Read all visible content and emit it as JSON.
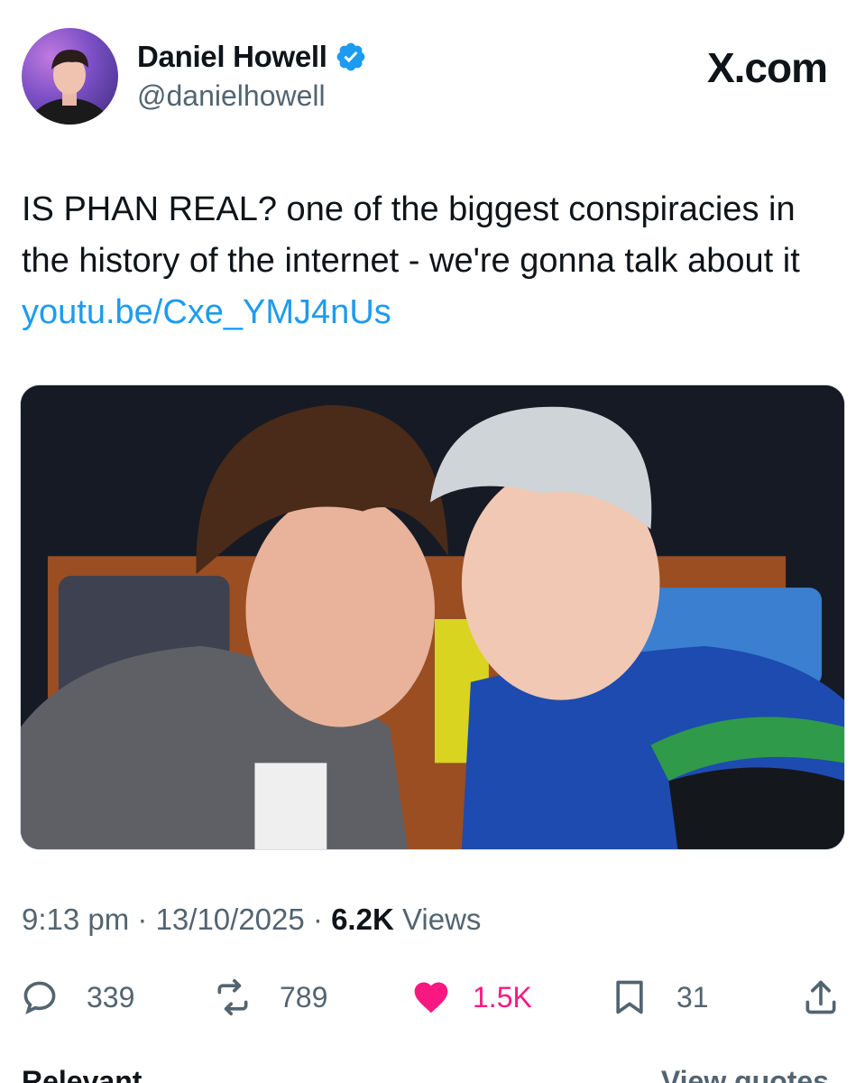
{
  "header": {
    "display_name": "Daniel Howell",
    "handle": "@danielhowell",
    "brand": "X.com",
    "verified_icon": "verified-badge-icon",
    "verified_color": "#1d9bf0"
  },
  "tweet": {
    "text": "IS PHAN REAL? one of the biggest conspiracies in the history of the internet - we're gonna talk about it ",
    "link": "youtu.be/Cxe_YMJ4nUs",
    "link_color": "#1d9bf0"
  },
  "meta": {
    "time": "9:13 pm",
    "separator1": " · ",
    "date": "13/10/2025",
    "separator2": " · ",
    "views_count": "6.2K",
    "views_label": " Views"
  },
  "actions": {
    "reply": {
      "icon": "reply-icon",
      "count": "339"
    },
    "repost": {
      "icon": "repost-icon",
      "count": "789"
    },
    "like": {
      "icon": "heart-icon",
      "count": "1.5K",
      "color": "#f91880"
    },
    "bookmark": {
      "icon": "bookmark-icon",
      "count": "31"
    },
    "share": {
      "icon": "share-icon"
    }
  },
  "bottom": {
    "left_label": "Relevant",
    "right_label": "View quotes"
  }
}
